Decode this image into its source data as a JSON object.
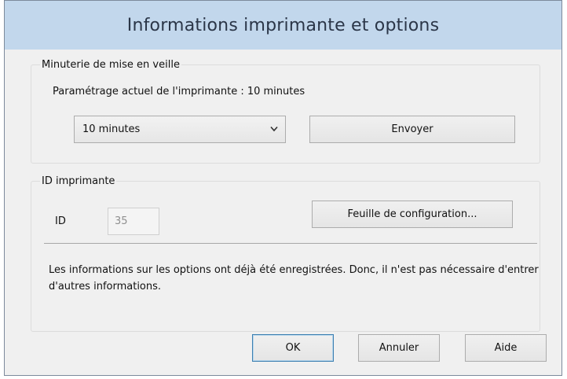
{
  "window": {
    "title": "Informations imprimante et options"
  },
  "sleep_timer": {
    "group_label": "Minuterie de mise en veille",
    "current_setting_text": "Paramétrage actuel de l'imprimante : 10 minutes",
    "dropdown": {
      "selected": "10 minutes",
      "chevron_icon": "chevron-down-icon"
    },
    "send_label": "Envoyer"
  },
  "printer_id": {
    "group_label": "ID imprimante",
    "id_label": "ID",
    "id_value": "35",
    "config_sheet_label": "Feuille de configuration..."
  },
  "info_text": "Les informations sur les options ont déjà été enregistrées. Donc, il n'est pas nécessaire d'entrer d'autres informations.",
  "buttons": {
    "ok": "OK",
    "cancel": "Annuler",
    "help": "Aide"
  },
  "colors": {
    "title_bar": "#c2d7ec",
    "window_bg": "#f0f0f0",
    "default_button_border": "#3c7fb1"
  }
}
